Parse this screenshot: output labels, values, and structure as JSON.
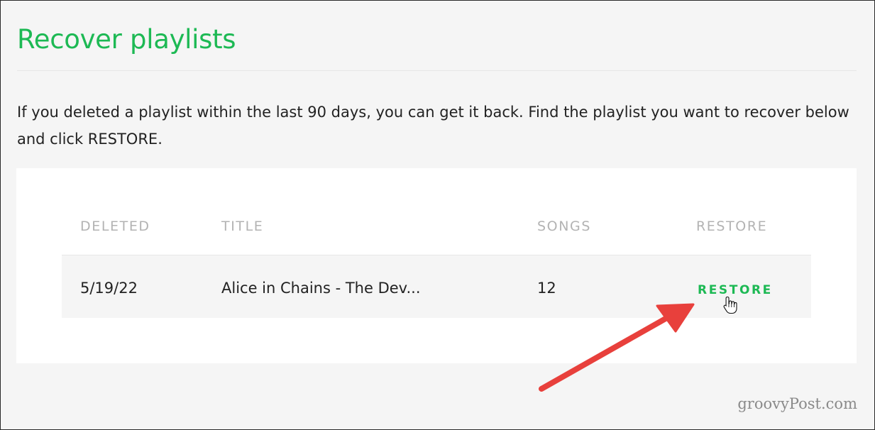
{
  "page": {
    "title": "Recover playlists",
    "intro": "If you deleted a playlist within the last 90 days, you can get it back. Find the playlist you want to recover below and click RESTORE."
  },
  "table": {
    "columns": [
      "DELETED",
      "TITLE",
      "SONGS",
      "RESTORE"
    ],
    "rows": [
      {
        "deleted": "5/19/22",
        "title": "Alice in Chains - The Dev...",
        "songs": "12",
        "action": "RESTORE"
      }
    ]
  },
  "watermark": "groovyPost.com",
  "colors": {
    "accent": "#1db954",
    "annotation_arrow": "#e8403c",
    "header_text": "#b3b3b3",
    "background": "#f5f5f5"
  },
  "icons": {
    "cursor": "hand-pointer-icon",
    "annotation": "red-arrow-icon"
  }
}
